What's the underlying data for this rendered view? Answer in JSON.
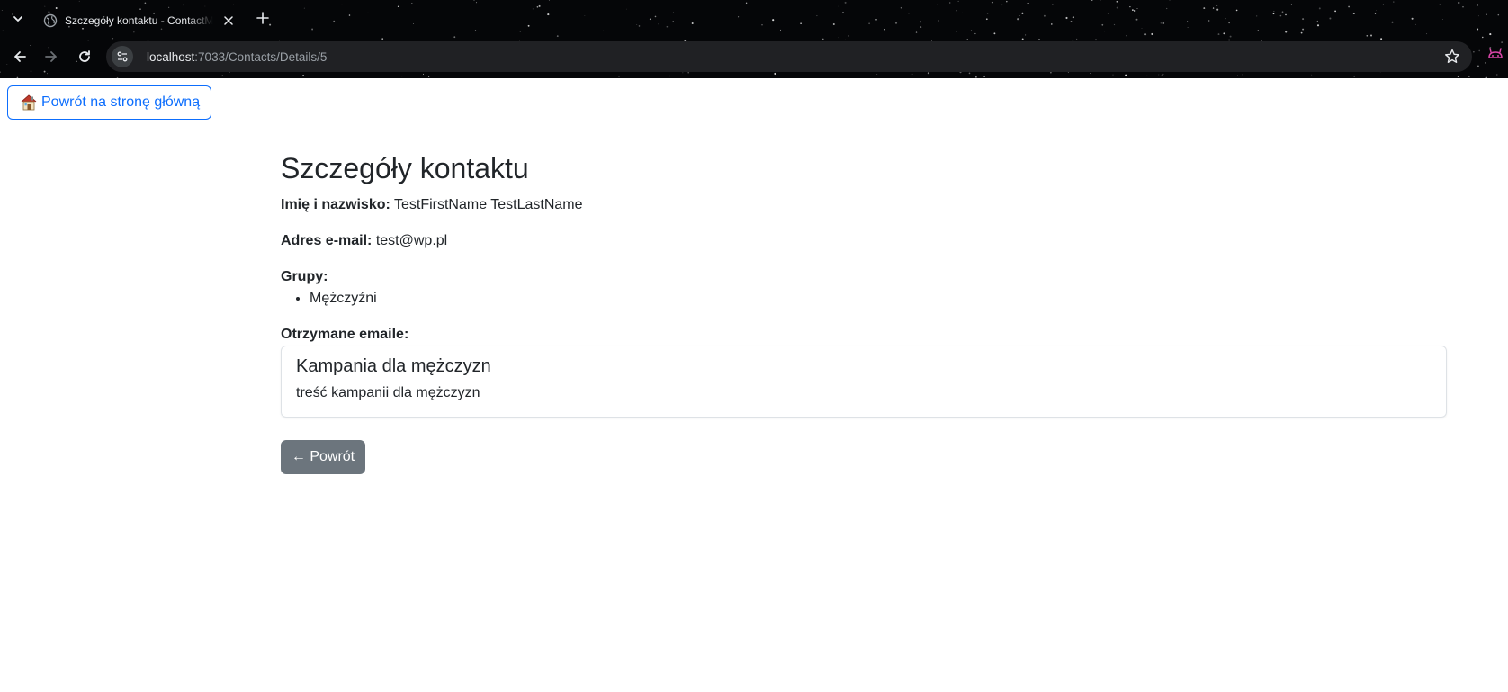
{
  "browser": {
    "tab": {
      "title": "Szczegóły kontaktu - ContactManager",
      "favicon": "globe-icon"
    },
    "address": {
      "host": "localhost",
      "path": ":7033/Contacts/Details/5"
    },
    "icons": {
      "menu": "chevron-down-icon",
      "close": "close-icon",
      "new_tab": "plus-icon",
      "back": "arrow-left-icon",
      "forward": "arrow-right-icon",
      "reload": "reload-icon",
      "site_info": "tune-icon",
      "bookmark": "star-icon",
      "extension": "extension-icon"
    }
  },
  "nav": {
    "home_label": "Powrót na stronę główną",
    "home_icon": "house-icon"
  },
  "contact": {
    "page_title": "Szczegóły kontaktu",
    "name_label": "Imię i nazwisko:",
    "name_value": "TestFirstName TestLastName",
    "email_label": "Adres e-mail:",
    "email_value": "test@wp.pl",
    "groups_label": "Grupy:",
    "groups": [
      "Mężczyźni"
    ],
    "emails_label": "Otrzymane emaile:",
    "emails": [
      {
        "subject": "Kampania dla mężczyzn",
        "body": "treść kampanii dla mężczyzn"
      }
    ],
    "back_label": "← Powrót"
  },
  "colors": {
    "primary": "#0d6efd",
    "secondary": "#6c757d",
    "text": "#212529",
    "chrome_bg": "#050608",
    "omnibox_bg": "#202124"
  }
}
